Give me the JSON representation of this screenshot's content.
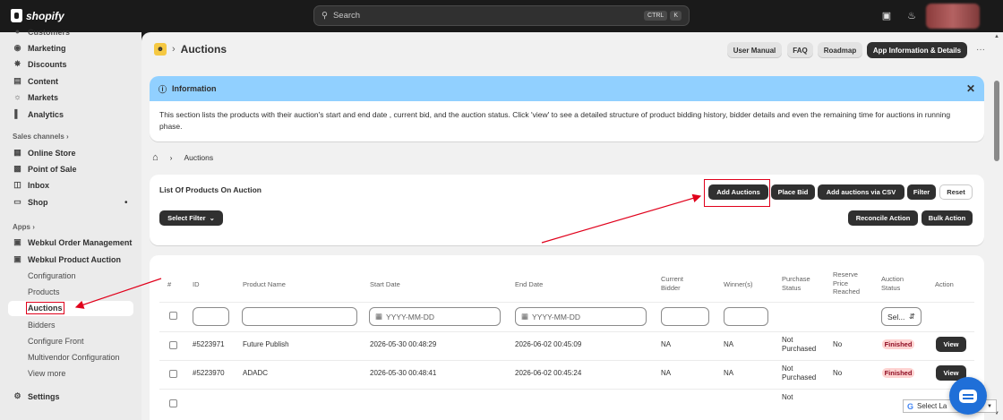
{
  "topbar": {
    "brand": "shopify",
    "search_placeholder": "Search",
    "shortcut_keys": [
      "CTRL",
      "K"
    ],
    "icons": [
      "shop-icon",
      "bell-icon"
    ]
  },
  "sidebar": {
    "partial_item": "Customers",
    "items": [
      {
        "label": "Marketing",
        "icon": "target-icon"
      },
      {
        "label": "Discounts",
        "icon": "discount-icon"
      },
      {
        "label": "Content",
        "icon": "content-icon"
      },
      {
        "label": "Markets",
        "icon": "globe-icon"
      },
      {
        "label": "Analytics",
        "icon": "bar-chart-icon"
      }
    ],
    "sales_channels_title": "Sales channels",
    "sales_channels": [
      {
        "label": "Online Store",
        "icon": "store-icon"
      },
      {
        "label": "Point of Sale",
        "icon": "pos-icon"
      },
      {
        "label": "Inbox",
        "icon": "inbox-icon"
      },
      {
        "label": "Shop",
        "icon": "bag-icon"
      }
    ],
    "apps_title": "Apps",
    "apps": [
      {
        "label": "Webkul Order Management",
        "icon": "app-icon"
      },
      {
        "label": "Webkul Product Auction",
        "icon": "app-icon"
      }
    ],
    "sub_items": [
      "Configuration",
      "Products",
      "Auctions",
      "Bidders",
      "Configure Front",
      "Multivendor Configuration",
      "View more"
    ],
    "active_sub_item": "Auctions",
    "settings": "Settings"
  },
  "header": {
    "breadcrumb_separator": "›",
    "title": "Auctions",
    "buttons": [
      "User Manual",
      "FAQ",
      "Roadmap",
      "App Information & Details"
    ],
    "more": "···"
  },
  "info": {
    "title": "Information",
    "text": "This section lists the products with their auction's start and end date , current bid, and the auction status. Click 'view' to see a detailed structure of product bidding history, bidder details and even the remaining time for auctions in running phase."
  },
  "breadcrumb": {
    "current": "Auctions"
  },
  "actions": {
    "title": "List Of Products On Auction",
    "buttons": [
      "Add Auctions",
      "Place Bid",
      "Add auctions via CSV",
      "Filter",
      "Reset"
    ],
    "select_filter": "Select Filter",
    "bulk_buttons": [
      "Reconcile Action",
      "Bulk Action"
    ]
  },
  "table": {
    "headers": [
      "#",
      "ID",
      "Product Name",
      "Start Date",
      "End Date",
      "Current Bidder",
      "Winner(s)",
      "Purchase Status",
      "Reserve Price Reached",
      "Auction Status",
      "Action"
    ],
    "date_placeholder": "YYYY-MM-DD",
    "status_select": "Sel...",
    "rows": [
      {
        "id": "#5223971",
        "product": "Future Publish",
        "start": "2026-05-30 00:48:29",
        "end": "2026-06-02 00:45:09",
        "bidder": "NA",
        "winner": "NA",
        "purchase": "Not Purchased",
        "reserve": "No",
        "status": "Finished",
        "action": "View"
      },
      {
        "id": "#5223970",
        "product": "ADADC",
        "start": "2026-05-30 00:48:41",
        "end": "2026-06-02 00:45:24",
        "bidder": "NA",
        "winner": "NA",
        "purchase": "Not Purchased",
        "reserve": "No",
        "status": "Finished",
        "action": "View"
      },
      {
        "id": "",
        "product": "",
        "start": "",
        "end": "",
        "bidder": "",
        "winner": "",
        "purchase": "Not",
        "reserve": "",
        "status": "",
        "action": ""
      }
    ]
  },
  "translate": {
    "label": "Select La"
  },
  "colors": {
    "info_banner": "#91d0ff",
    "finished_badge": "#fed3d1",
    "annotation_red": "#e0001b",
    "chat_button": "#1f6fd8"
  }
}
